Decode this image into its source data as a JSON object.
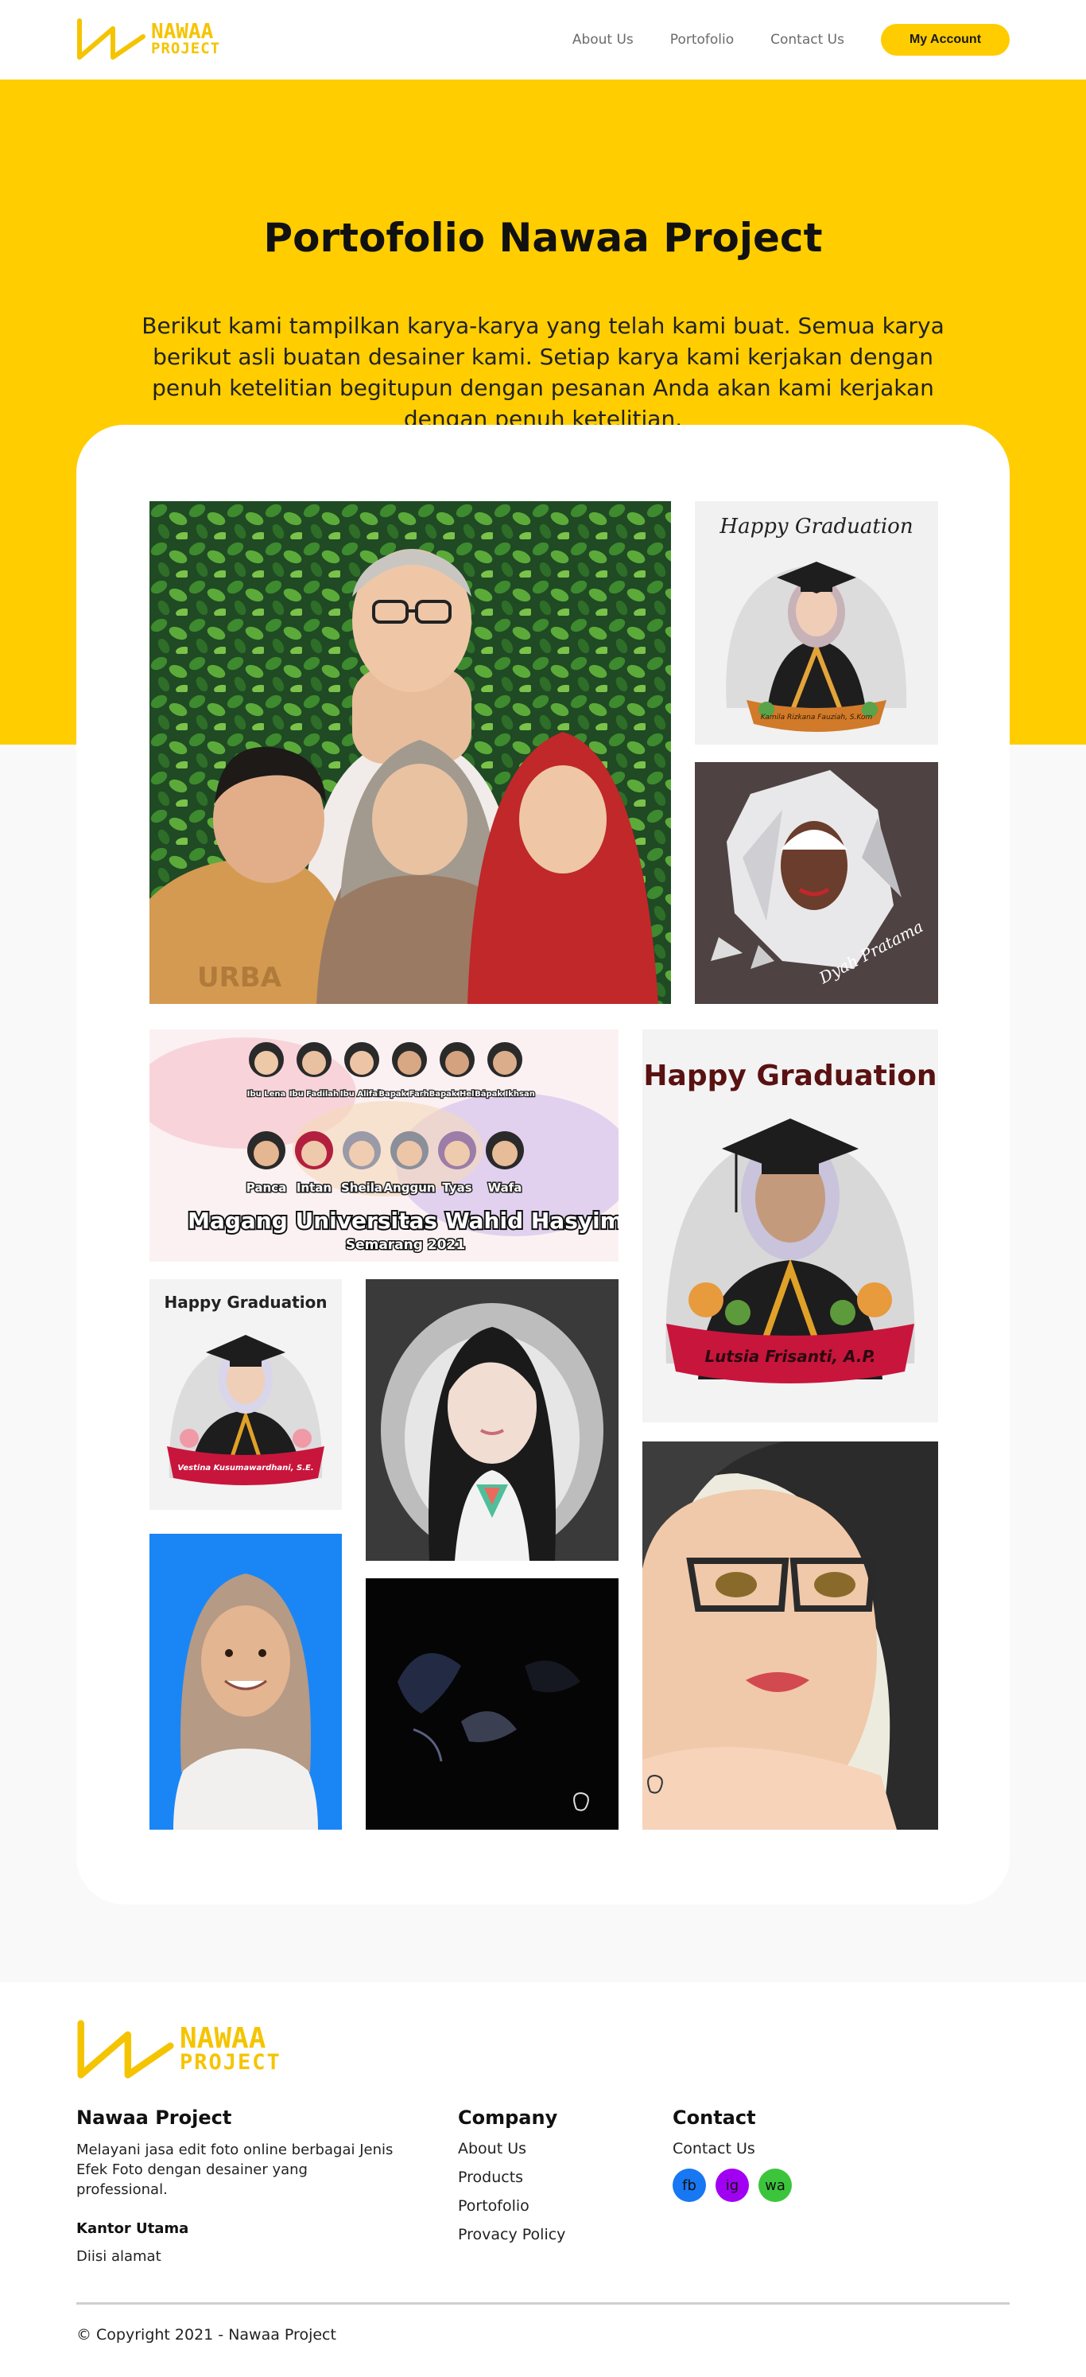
{
  "brand": {
    "line1": "NAWAA",
    "line2": "PROJECT",
    "color": "#f5c400"
  },
  "nav": {
    "links": [
      "About Us",
      "Portofolio",
      "Contact Us"
    ],
    "account_label": "My Account"
  },
  "hero": {
    "title": "Portofolio Nawaa Project",
    "description": "Berikut kami tampilkan karya-karya yang telah kami buat. Semua karya berikut asli buatan desainer kami. Setiap karya kami kerjakan dengan penuh ketelitian begitupun dengan pesanan Anda akan kami kerjakan dengan penuh ketelitian.",
    "bg_color": "#ffcd00"
  },
  "gallery": {
    "grad1_caption": "Happy Graduation",
    "grad1_name": "Kamila Rizkana Fauziah, S.Kom",
    "lowpoly_signature": "Dyah Pratama",
    "magang_title": "Magang Universitas Wahid Hasyim",
    "magang_subtitle": "Semarang 2021",
    "magang_row1": [
      "Ibu Lena",
      "Ibu Fadilah",
      "Ibu Alifah",
      "Bapak Farhan",
      "Bapak Helmi",
      "Bapak Ikhsan"
    ],
    "magang_row2": [
      "Panca",
      "Intan",
      "Sheila",
      "Anggun",
      "Tyas",
      "Wafa"
    ],
    "grad2_caption": "Happy Graduation",
    "grad2_name": "Lutsia Frisanti, A.P.",
    "grad3_caption": "Happy Graduation",
    "grad3_name": "Vestina Kusumawardhani, S.E."
  },
  "footer": {
    "about_title": "Nawaa Project",
    "about_text": "Melayani jasa edit foto online berbagai Jenis Efek Foto dengan desainer yang professional.",
    "office_label": "Kantor Utama",
    "office_address": "Diisi alamat",
    "company_title": "Company",
    "company_links": [
      "About Us",
      "Products",
      "Portofolio",
      "Provacy Policy"
    ],
    "contact_title": "Contact",
    "contact_link": "Contact Us",
    "socials": [
      {
        "label": "fb",
        "color": "#1877f2"
      },
      {
        "label": "ig",
        "color": "#a100f2"
      },
      {
        "label": "wa",
        "color": "#3cc53c"
      }
    ],
    "copyright": "© Copyright 2021 - Nawaa Project"
  }
}
